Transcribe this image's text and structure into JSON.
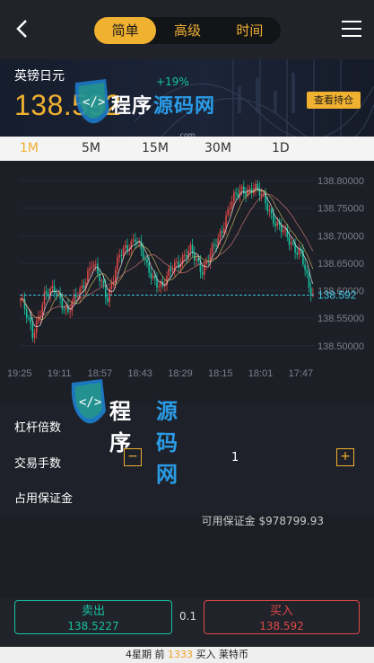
{
  "header": {
    "tabs": [
      {
        "label": "简单",
        "active": true
      },
      {
        "label": "高级",
        "active": false
      },
      {
        "label": "时间",
        "active": false
      }
    ]
  },
  "banner": {
    "pair": "英镑日元",
    "price": "138.592",
    "change": "+19%",
    "view_positions_label": "查看持仓"
  },
  "watermark": {
    "text1": "程序",
    "text2": "源码网",
    "sub": ".com"
  },
  "periods": [
    {
      "label": "1M",
      "active": true
    },
    {
      "label": "5M",
      "active": false
    },
    {
      "label": "15M",
      "active": false
    },
    {
      "label": "30M",
      "active": false
    },
    {
      "label": "1D",
      "active": false
    }
  ],
  "chart_data": {
    "type": "candlestick",
    "ylim": [
      138.48,
      138.81
    ],
    "yticks": [
      "138.80000",
      "138.75000",
      "138.70000",
      "138.65000",
      "138.60000",
      "138.55000",
      "138.50000"
    ],
    "xticks": [
      "19:25",
      "19:11",
      "18:57",
      "18:43",
      "18:29",
      "18:15",
      "18:01",
      "17:47"
    ],
    "current_price": 138.592,
    "current_price_label": "138.592",
    "colors": {
      "up": "#e04848",
      "down": "#17c2a0",
      "ma1": "#ffffff",
      "ma2": "#d9c36a",
      "ma3": "#e08080"
    }
  },
  "form": {
    "leverage_label": "杠杆倍数",
    "lots_label": "交易手数",
    "minus": "−",
    "plus": "+",
    "lots_value": "1",
    "margin_label": "占用保证金"
  },
  "available_margin": "可用保证金 $978799.93",
  "trade": {
    "sell_label": "卖出",
    "sell_price": "138.5227",
    "spread": "0.1",
    "buy_label": "买入",
    "buy_price": "138.592"
  },
  "status_bar": {
    "prefix": "4星期 前 ",
    "count": "1333",
    "suffix": " 买入 莱特币"
  }
}
